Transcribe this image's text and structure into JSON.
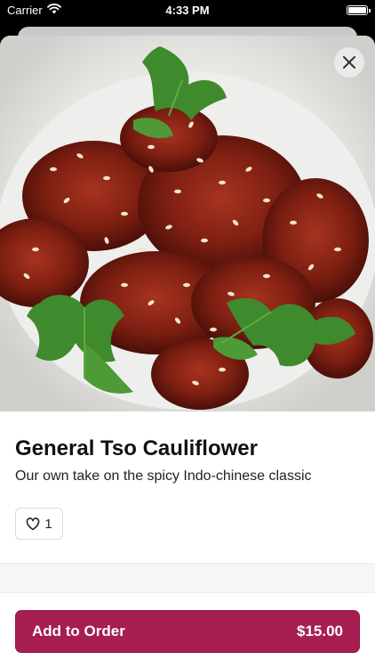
{
  "status_bar": {
    "carrier": "Carrier",
    "time": "4:33 PM"
  },
  "item": {
    "title": "General Tso Cauliflower",
    "description": "Our own take on the spicy Indo-chinese classic",
    "likes": "1"
  },
  "order": {
    "button_label": "Add to Order",
    "price": "$15.00"
  },
  "icons": {
    "close": "close-icon",
    "like": "heart-icon",
    "wifi": "wifi-icon",
    "battery": "battery-icon"
  },
  "colors": {
    "accent": "#a61e52",
    "background": "#ffffff"
  }
}
